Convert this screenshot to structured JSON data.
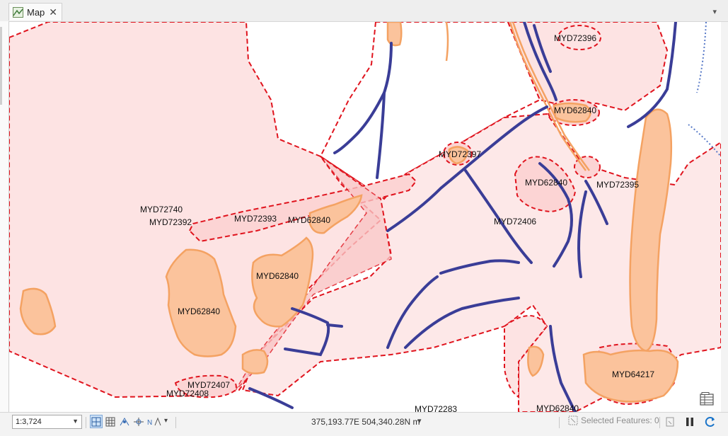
{
  "tab": {
    "title": "Map",
    "close_glyph": "✕",
    "icon": "map-icon"
  },
  "map": {
    "labels": [
      {
        "id": "lbl-myd72396",
        "text": "MYD72396"
      },
      {
        "id": "lbl-myd62840-a",
        "text": "MYD62840"
      },
      {
        "id": "lbl-myd72397",
        "text": "MYD72397"
      },
      {
        "id": "lbl-myd62840-b",
        "text": "MYD62840"
      },
      {
        "id": "lbl-myd72395",
        "text": "MYD72395"
      },
      {
        "id": "lbl-myd72740",
        "text": "MYD72740"
      },
      {
        "id": "lbl-myd72392",
        "text": "MYD72392"
      },
      {
        "id": "lbl-myd72393",
        "text": "MYD72393"
      },
      {
        "id": "lbl-myd62840-c",
        "text": "MYD62840"
      },
      {
        "id": "lbl-myd72406",
        "text": "MYD72406"
      },
      {
        "id": "lbl-myd62840-d",
        "text": "MYD62840"
      },
      {
        "id": "lbl-myd62840-e",
        "text": "MYD62840"
      },
      {
        "id": "lbl-myd72407",
        "text": "MYD72407"
      },
      {
        "id": "lbl-myd72408",
        "text": "MYD72408"
      },
      {
        "id": "lbl-myd72283",
        "text": "MYD72283"
      },
      {
        "id": "lbl-myd62840-f",
        "text": "MYD62840"
      },
      {
        "id": "lbl-myd64217",
        "text": "MYD64217"
      }
    ],
    "colors": {
      "zone_fill": "#fde3e3",
      "zone_fill_dark": "#f9c4c4",
      "zone_border": "#e0141e",
      "orange_fill": "#fbc39c",
      "orange_border": "#f4a262",
      "line_blue": "#3a3d97",
      "dotted_blue": "#5a7bc8"
    }
  },
  "status": {
    "scale": "1:3,724",
    "coordinates": "375,193.77E 504,340.28N m",
    "selected_features": "Selected Features: 0"
  }
}
